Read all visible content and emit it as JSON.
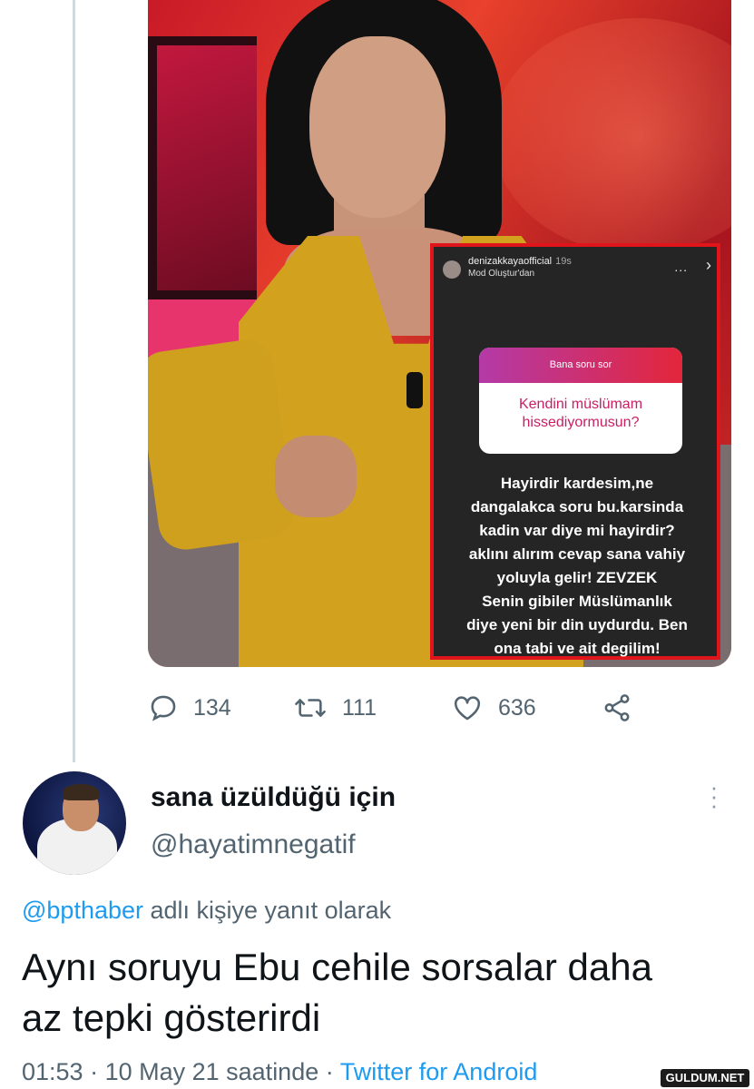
{
  "story": {
    "username": "denizakkayaofficial",
    "time": "19s",
    "mode": "Mod Oluştur'dan",
    "menu_glyph": "...",
    "close_glyph": "›",
    "question_header": "Bana soru sor",
    "question_line1": "Kendini müslümam",
    "question_line2": "hissediyormusun?",
    "answer_lines": [
      "Hayirdir kardesim,ne",
      "dangalakca soru  bu.karsinda",
      "kadin var diye mi hayirdir?",
      "aklını alırım  cevap sana vahiy",
      "yoluyla gelir! ZEVZEK",
      "Senin gibiler  Müslümanlık",
      "diye yeni bir din uydurdu. Ben",
      "ona tabi ve ait degilim!"
    ]
  },
  "actions": {
    "replies": "134",
    "retweets": "111",
    "likes": "636",
    "icons": [
      "reply-icon",
      "retweet-icon",
      "like-icon",
      "share-icon"
    ]
  },
  "reply_tweet": {
    "display_name": "sana üzüldüğü için",
    "handle": "@hayatimnegatif",
    "replying_mention": "@bpthaber",
    "replying_suffix": " adlı kişiye yanıt olarak",
    "text_line1": "Aynı soruyu Ebu cehile sorsalar daha",
    "text_line2": "az tepki gösterirdi",
    "time": "01:53",
    "separator": " · ",
    "date": "10 May 21 saatinde",
    "source": "Twitter for Android"
  },
  "watermark": "GULDUM.NET",
  "colors": {
    "accent": "#1d9bf0",
    "secondary_text": "#536471",
    "story_border": "#e0141b"
  }
}
